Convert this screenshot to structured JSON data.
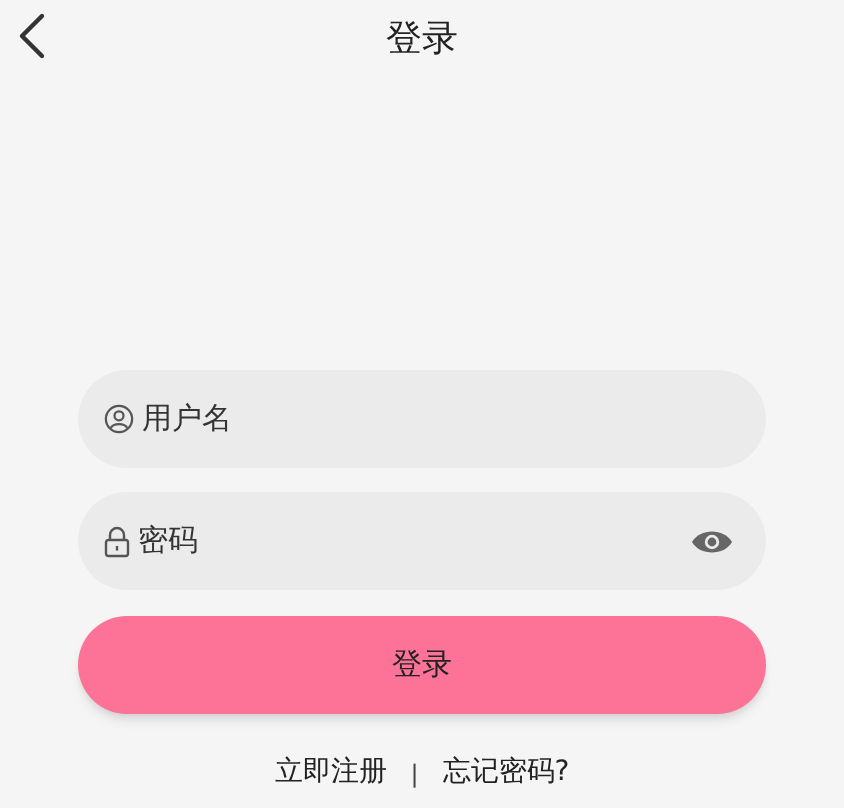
{
  "header": {
    "title": "登录"
  },
  "fields": [
    {
      "kind": "user",
      "placeholder": "用户名"
    },
    {
      "kind": "password",
      "placeholder": "密码"
    }
  ],
  "login_button": "登录",
  "links": {
    "register": "立即注册",
    "separator": "|",
    "forgot": "忘记密码?"
  }
}
